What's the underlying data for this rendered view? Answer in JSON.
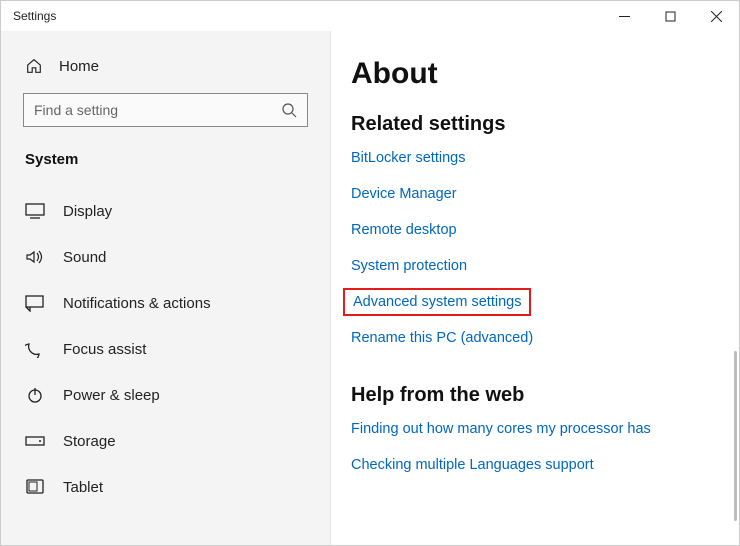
{
  "window": {
    "title": "Settings"
  },
  "sidebar": {
    "home_label": "Home",
    "search_placeholder": "Find a setting",
    "category_label": "System",
    "items": [
      {
        "label": "Display",
        "icon": "display-icon"
      },
      {
        "label": "Sound",
        "icon": "sound-icon"
      },
      {
        "label": "Notifications & actions",
        "icon": "notifications-icon"
      },
      {
        "label": "Focus assist",
        "icon": "focus-assist-icon"
      },
      {
        "label": "Power & sleep",
        "icon": "power-icon"
      },
      {
        "label": "Storage",
        "icon": "storage-icon"
      },
      {
        "label": "Tablet",
        "icon": "tablet-icon"
      }
    ]
  },
  "main": {
    "page_title": "About",
    "related_heading": "Related settings",
    "related_links": [
      "BitLocker settings",
      "Device Manager",
      "Remote desktop",
      "System protection",
      "Advanced system settings",
      "Rename this PC (advanced)"
    ],
    "highlight_index": 4,
    "help_heading": "Help from the web",
    "help_links": [
      "Finding out how many cores my processor has",
      "Checking multiple Languages support"
    ]
  }
}
